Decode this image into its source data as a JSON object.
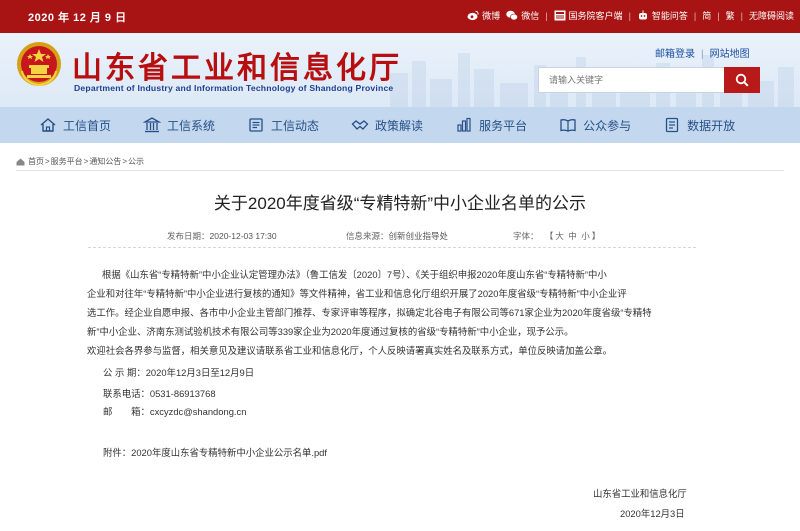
{
  "topbar": {
    "date": "2020 年 12 月 9 日",
    "links": {
      "weibo": "微博",
      "wechat": "微信",
      "gov_client": "国务院客户端",
      "ai_qa": "智能问答",
      "simplified": "简",
      "traditional": "繁",
      "accessibility": "无障碍阅读"
    }
  },
  "header": {
    "title_cn": "山东省工业和信息化厅",
    "title_en": "Department of Industry and Information Technology of Shandong Province",
    "mailbox": "邮箱登录",
    "sitemap": "网站地图",
    "search_placeholder": "请输入关键字"
  },
  "nav": {
    "items": [
      "工信首页",
      "工信系统",
      "工信动态",
      "政策解读",
      "服务平台",
      "公众参与",
      "数据开放"
    ]
  },
  "breadcrumb": {
    "home": "首页",
    "service": "服务平台",
    "notice": "通知公告",
    "current": "公示"
  },
  "article": {
    "title": "关于2020年度省级“专精特新”中小企业名单的公示",
    "publish_label": "发布日期：",
    "publish_date": "2020-12-03 17:30",
    "source_label": "信息来源：",
    "source": "创新创业指导处",
    "font_label": "字体：",
    "font_open": "【",
    "font_large": "大",
    "font_medium": "中",
    "font_small": "小",
    "font_close": "】",
    "para1_line1": "根据《山东省“专精特新”中小企业认定管理办法》（鲁工信发〔2020〕7号）、《关于组织申报2020年度山东省“专精特新”中小",
    "para1_line2": "企业和对往年“专精特新”中小企业进行复核的通知》等文件精神，省工业和信息化厅组织开展了2020年度省级“专精特新”中小企业评",
    "para1_line3": "选工作。经企业自愿申报、各市中小企业主管部门推荐、专家评审等程序，拟确定北谷电子有限公司等671家企业为2020年度省级“专精特",
    "para1_line4": "新”中小企业、济南东测试验机技术有限公司等339家企业为2020年度通过复核的省级“专精特新”中小企业，现予公示。",
    "para2": "欢迎社会各界参与监督，相关意见及建议请联系省工业和信息化厅，个人反映请署真实姓名及联系方式，单位反映请加盖公章。",
    "period": "公 示 期：2020年12月3日至12月9日",
    "phone": "联系电话：0531-86913768",
    "email": "邮　　箱：cxcyzdc@shandong.cn",
    "attachment": "附件：2020年度山东省专精特新中小企业公示名单.pdf",
    "signature": "山东省工业和信息化厅",
    "sign_date": "2020年12月3日"
  },
  "colors": {
    "brand_red": "#a81313",
    "nav_blue": "#c3d8ef",
    "nav_text": "#264f86"
  }
}
